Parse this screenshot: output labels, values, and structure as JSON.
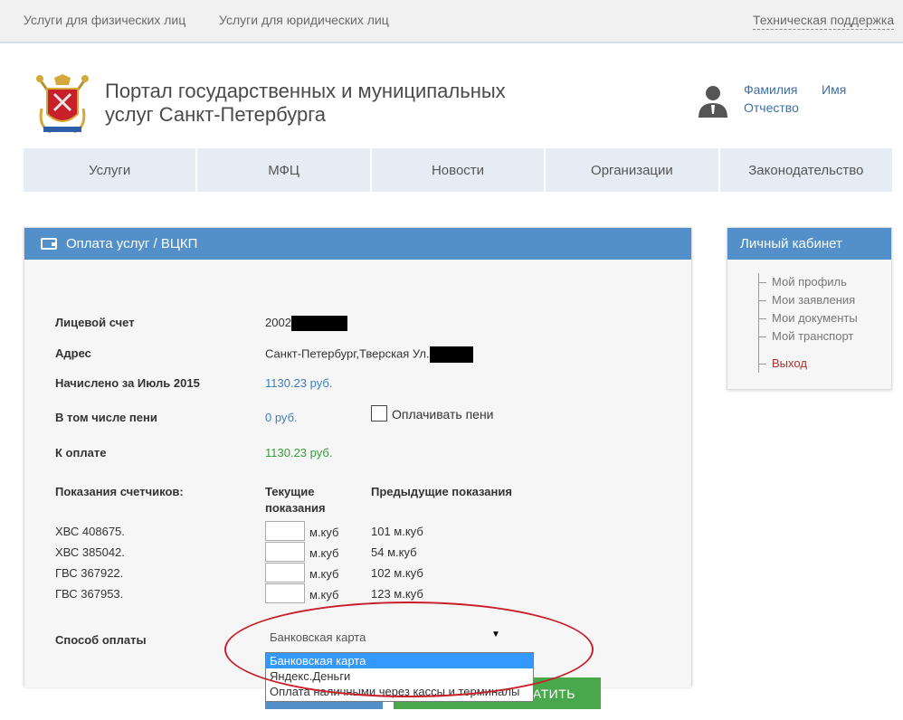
{
  "topbar": {
    "individuals": "Услуги для физических лиц",
    "legal": "Услуги для юридических лиц",
    "support": "Техническая поддержка"
  },
  "header": {
    "title": "Портал государственных и муниципальных услуг Санкт-Петербурга",
    "user": {
      "surname": "Фамилия",
      "name": "Имя",
      "patronymic": "Отчество"
    }
  },
  "nav": [
    "Услуги",
    "МФЦ",
    "Новости",
    "Организации",
    "Законодательство"
  ],
  "panel": {
    "title": "Оплата услуг / ВЦКП",
    "account_label": "Лицевой счет",
    "account_value": "2002",
    "address_label": "Адрес",
    "address_value": "Санкт-Петербург,Тверская Ул.",
    "charged_label": "Начислено за Июль 2015",
    "charged_value": "1130.23 руб.",
    "penalty_label": "В том числе пени",
    "penalty_value": "0 руб.",
    "pay_penalty": "Оплачивать пени",
    "due_label": "К оплате",
    "due_value": "1130.23 руб.",
    "meters_label": "Показания счетчиков:",
    "col_current": "Текущие показания",
    "col_previous": "Предыдущие показания",
    "meters": [
      {
        "name": "ХВС 408675.",
        "unit": "м.куб",
        "prev": "101 м.куб"
      },
      {
        "name": "ХВС 385042.",
        "unit": "м.куб",
        "prev": "54 м.куб"
      },
      {
        "name": "ГВС 367922.",
        "unit": "м.куб",
        "prev": "102 м.куб"
      },
      {
        "name": "ГВС 367953.",
        "unit": "м.куб",
        "prev": "123 м.куб"
      }
    ],
    "payment_label": "Способ оплаты",
    "payment_selected": "Банковская карта",
    "payment_options": [
      "Банковская карта",
      "Яндекс.Деньги",
      "Оплата наличными через кассы и терминалы"
    ],
    "pay_button": "АТИТЬ"
  },
  "side": {
    "title": "Личный кабинет",
    "items": [
      "Мой профиль",
      "Мои заявления",
      "Мои документы",
      "Мой транспорт"
    ],
    "exit": "Выход"
  },
  "colors": {
    "accent": "#5390c9",
    "green": "#4aa84c",
    "link": "#3f6fa7",
    "annotation": "#c8202a"
  }
}
